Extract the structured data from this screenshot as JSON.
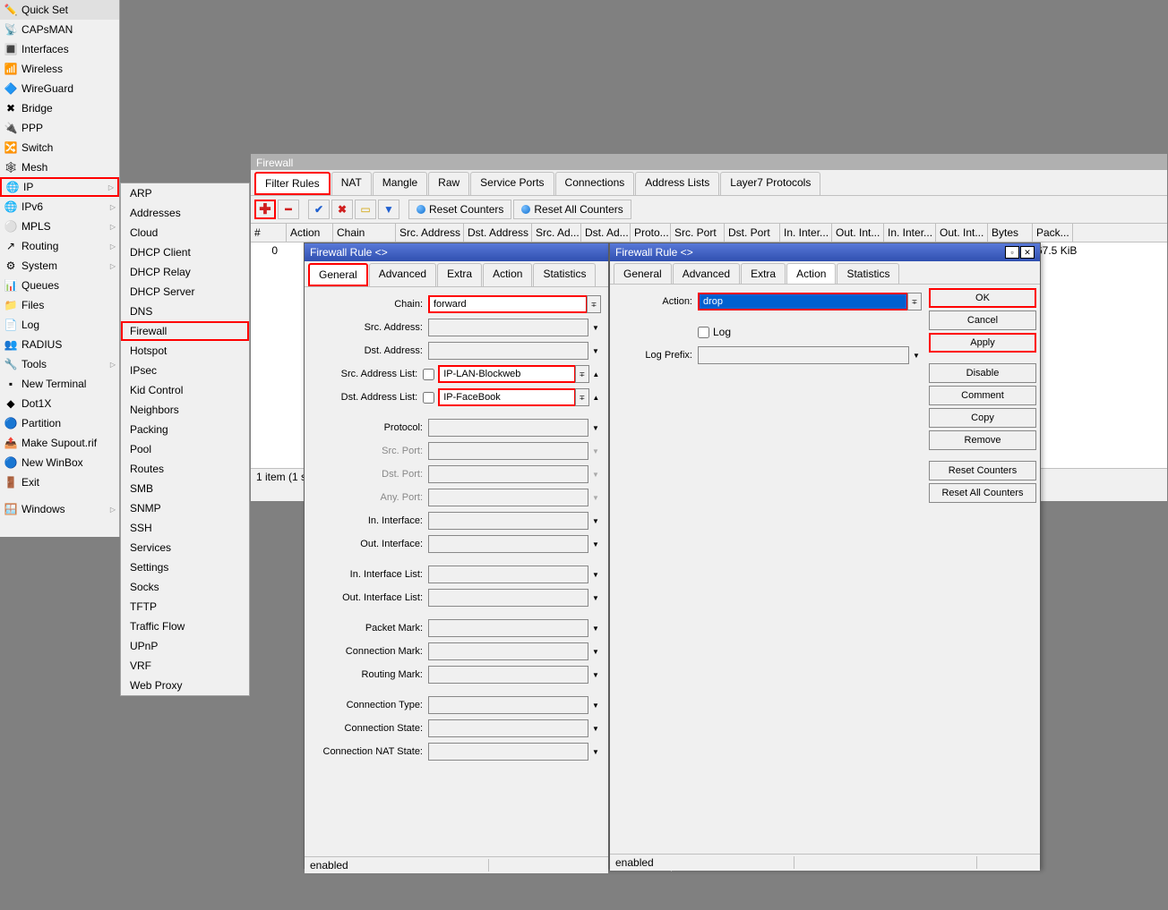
{
  "sidebar": {
    "items": [
      {
        "label": "Quick Set",
        "icon": "✏️"
      },
      {
        "label": "CAPsMAN",
        "icon": "📡"
      },
      {
        "label": "Interfaces",
        "icon": "🔳"
      },
      {
        "label": "Wireless",
        "icon": "📶"
      },
      {
        "label": "WireGuard",
        "icon": "🔷"
      },
      {
        "label": "Bridge",
        "icon": "✖"
      },
      {
        "label": "PPP",
        "icon": "🔌"
      },
      {
        "label": "Switch",
        "icon": "🔀"
      },
      {
        "label": "Mesh",
        "icon": "🕸"
      },
      {
        "label": "IP",
        "icon": "🌐",
        "arrow": true,
        "highlight": true
      },
      {
        "label": "IPv6",
        "icon": "🌐",
        "arrow": true
      },
      {
        "label": "MPLS",
        "icon": "⚪",
        "arrow": true
      },
      {
        "label": "Routing",
        "icon": "↗",
        "arrow": true
      },
      {
        "label": "System",
        "icon": "⚙",
        "arrow": true
      },
      {
        "label": "Queues",
        "icon": "📊"
      },
      {
        "label": "Files",
        "icon": "📁"
      },
      {
        "label": "Log",
        "icon": "📄"
      },
      {
        "label": "RADIUS",
        "icon": "👥"
      },
      {
        "label": "Tools",
        "icon": "🔧",
        "arrow": true
      },
      {
        "label": "New Terminal",
        "icon": "▪"
      },
      {
        "label": "Dot1X",
        "icon": "◆"
      },
      {
        "label": "Partition",
        "icon": "🔵"
      },
      {
        "label": "Make Supout.rif",
        "icon": "📤"
      },
      {
        "label": "New WinBox",
        "icon": "🔵"
      },
      {
        "label": "Exit",
        "icon": "🚪"
      },
      {
        "label": "",
        "icon": ""
      },
      {
        "label": "Windows",
        "icon": "🪟",
        "arrow": true
      }
    ]
  },
  "subsidebar": {
    "items": [
      "ARP",
      "Addresses",
      "Cloud",
      "DHCP Client",
      "DHCP Relay",
      "DHCP Server",
      "DNS",
      "Firewall",
      "Hotspot",
      "IPsec",
      "Kid Control",
      "Neighbors",
      "Packing",
      "Pool",
      "Routes",
      "SMB",
      "SNMP",
      "SSH",
      "Services",
      "Settings",
      "Socks",
      "TFTP",
      "Traffic Flow",
      "UPnP",
      "VRF",
      "Web Proxy"
    ],
    "highlight": "Firewall"
  },
  "firewall": {
    "title": "Firewall",
    "tabs": [
      "Filter Rules",
      "NAT",
      "Mangle",
      "Raw",
      "Service Ports",
      "Connections",
      "Address Lists",
      "Layer7 Protocols"
    ],
    "active_tab": "Filter Rules",
    "toolbar": {
      "reset_counters": "Reset Counters",
      "reset_all_counters": "Reset All Counters"
    },
    "columns": [
      "#",
      "Action",
      "Chain",
      "Src. Address",
      "Dst. Address",
      "Src. Ad...",
      "Dst. Ad...",
      "Proto...",
      "Src. Port",
      "Dst. Port",
      "In. Inter...",
      "Out. Int...",
      "In. Inter...",
      "Out. Int...",
      "Bytes",
      "Pack..."
    ],
    "rows": [
      {
        "num": "0",
        "bytes": "67.5 KiB"
      }
    ],
    "status": "1 item (1 s"
  },
  "dialog1": {
    "title": "Firewall Rule <>",
    "tabs": [
      "General",
      "Advanced",
      "Extra",
      "Action",
      "Statistics"
    ],
    "active_tab": "General",
    "fields": {
      "chain_label": "Chain:",
      "chain_value": "forward",
      "src_addr_label": "Src. Address:",
      "dst_addr_label": "Dst. Address:",
      "src_list_label": "Src. Address List:",
      "src_list_value": "IP-LAN-Blockweb",
      "dst_list_label": "Dst. Address List:",
      "dst_list_value": "IP-FaceBook",
      "protocol_label": "Protocol:",
      "src_port_label": "Src. Port:",
      "dst_port_label": "Dst. Port:",
      "any_port_label": "Any. Port:",
      "in_iface_label": "In. Interface:",
      "out_iface_label": "Out. Interface:",
      "in_iface_list_label": "In. Interface List:",
      "out_iface_list_label": "Out. Interface List:",
      "packet_mark_label": "Packet Mark:",
      "conn_mark_label": "Connection Mark:",
      "routing_mark_label": "Routing Mark:",
      "conn_type_label": "Connection Type:",
      "conn_state_label": "Connection State:",
      "conn_nat_state_label": "Connection NAT State:"
    },
    "status": "enabled"
  },
  "dialog2": {
    "title": "Firewall Rule <>",
    "tabs": [
      "General",
      "Advanced",
      "Extra",
      "Action",
      "Statistics"
    ],
    "active_tab": "Action",
    "fields": {
      "action_label": "Action:",
      "action_value": "drop",
      "log_label": "Log",
      "log_prefix_label": "Log Prefix:"
    },
    "buttons": {
      "ok": "OK",
      "cancel": "Cancel",
      "apply": "Apply",
      "disable": "Disable",
      "comment": "Comment",
      "copy": "Copy",
      "remove": "Remove",
      "reset_counters": "Reset Counters",
      "reset_all": "Reset All Counters"
    },
    "status": "enabled"
  }
}
